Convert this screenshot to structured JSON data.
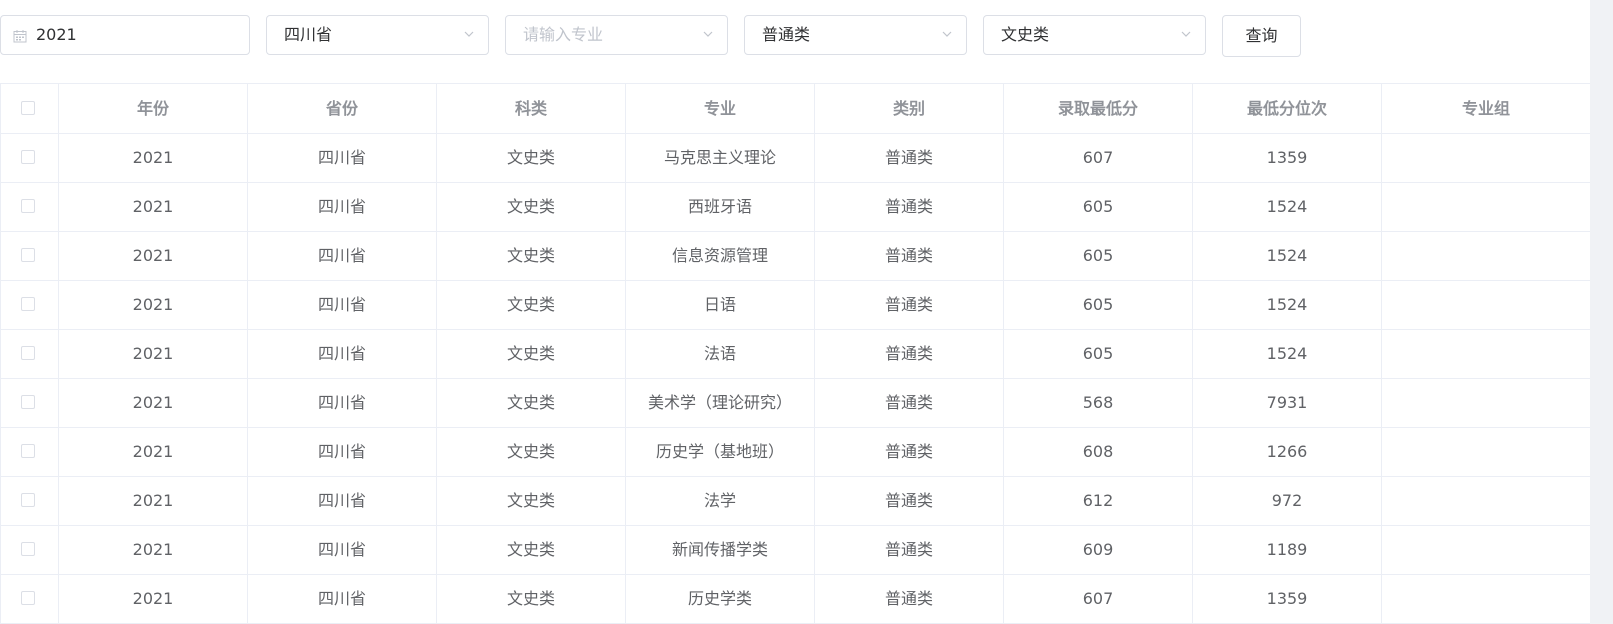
{
  "filters": {
    "year": "2021",
    "province": "四川省",
    "major_placeholder": "请输入专业",
    "category": "普通类",
    "subject": "文史类",
    "search_label": "查询"
  },
  "table": {
    "headers": [
      "年份",
      "省份",
      "科类",
      "专业",
      "类别",
      "录取最低分",
      "最低分位次",
      "专业组"
    ],
    "rows": [
      [
        "2021",
        "四川省",
        "文史类",
        "马克思主义理论",
        "普通类",
        "607",
        "1359",
        ""
      ],
      [
        "2021",
        "四川省",
        "文史类",
        "西班牙语",
        "普通类",
        "605",
        "1524",
        ""
      ],
      [
        "2021",
        "四川省",
        "文史类",
        "信息资源管理",
        "普通类",
        "605",
        "1524",
        ""
      ],
      [
        "2021",
        "四川省",
        "文史类",
        "日语",
        "普通类",
        "605",
        "1524",
        ""
      ],
      [
        "2021",
        "四川省",
        "文史类",
        "法语",
        "普通类",
        "605",
        "1524",
        ""
      ],
      [
        "2021",
        "四川省",
        "文史类",
        "美术学（理论研究）",
        "普通类",
        "568",
        "7931",
        ""
      ],
      [
        "2021",
        "四川省",
        "文史类",
        "历史学（基地班）",
        "普通类",
        "608",
        "1266",
        ""
      ],
      [
        "2021",
        "四川省",
        "文史类",
        "法学",
        "普通类",
        "612",
        "972",
        ""
      ],
      [
        "2021",
        "四川省",
        "文史类",
        "新闻传播学类",
        "普通类",
        "609",
        "1189",
        ""
      ],
      [
        "2021",
        "四川省",
        "文史类",
        "历史学类",
        "普通类",
        "607",
        "1359",
        ""
      ]
    ]
  },
  "icons": {
    "calendar": "calendar-icon",
    "dropdown": "chevron-down-icon"
  }
}
